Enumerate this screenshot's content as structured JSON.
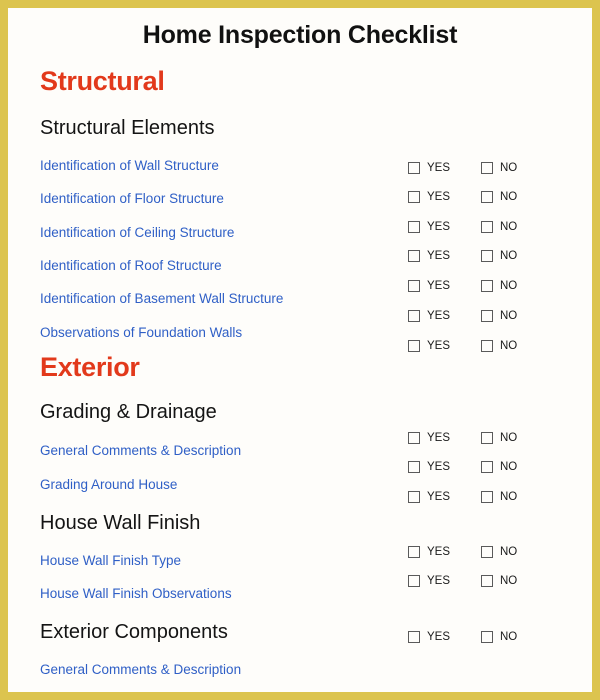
{
  "document": {
    "title": "Home Inspection Checklist",
    "colors": {
      "border": "#dcc44e",
      "background": "#fefdfa",
      "section_heading": "#e2391b",
      "group_heading": "#141414",
      "item_link": "#2f5fc6"
    }
  },
  "choices": {
    "yes_label": "YES",
    "no_label": "NO"
  },
  "sections": [
    {
      "heading": "Structural",
      "groups": [
        {
          "heading": "Structural Elements",
          "items": [
            "Identification of Wall Structure",
            "Identification of Floor Structure",
            "Identification of Ceiling Structure",
            "Identification of Roof Structure",
            "Identification of Basement Wall Structure",
            "Observations of Foundation Walls"
          ]
        }
      ]
    },
    {
      "heading": "Exterior",
      "groups": [
        {
          "heading": "Grading & Drainage",
          "items": [
            "General Comments & Description",
            "Grading Around House"
          ]
        },
        {
          "heading": "House Wall Finish",
          "items": [
            "House Wall Finish Type",
            "House Wall Finish Observations"
          ]
        },
        {
          "heading": "Exterior Components",
          "items": [
            "General Comments & Description"
          ]
        }
      ]
    }
  ],
  "flat_items": {
    "i0": "Identification of Wall Structure",
    "i1": "Identification of Floor Structure",
    "i2": "Identification of Ceiling Structure",
    "i3": "Identification of Roof Structure",
    "i4": "Identification of Basement Wall Structure",
    "i5": "Observations of Foundation Walls",
    "i6": "General Comments & Description",
    "i7": "Grading Around House",
    "i8": "House Wall Finish Type",
    "i9": "House Wall Finish Observations",
    "i10": "General Comments & Description"
  },
  "headings": {
    "structural": "Structural",
    "structural_elements": "Structural Elements",
    "exterior": "Exterior",
    "grading_drainage": "Grading & Drainage",
    "house_wall_finish": "House Wall Finish",
    "exterior_components": "Exterior Components"
  },
  "watermark": {
    "text": ""
  }
}
